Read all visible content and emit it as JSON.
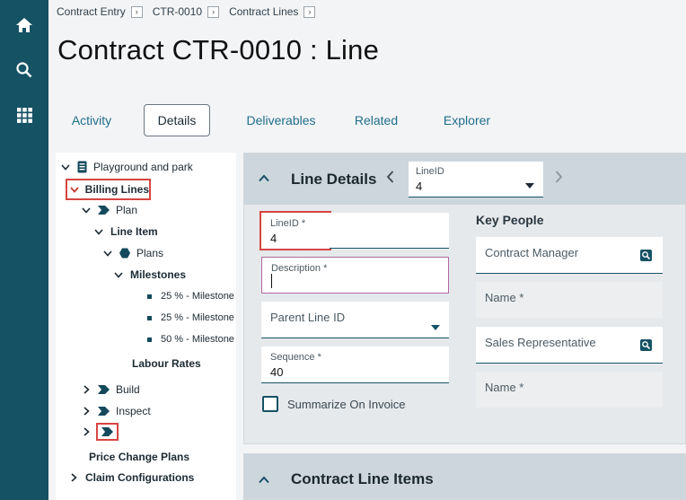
{
  "rail": {
    "items": [
      {
        "icon": "home-icon"
      },
      {
        "icon": "search-icon"
      },
      {
        "icon": "grid-icon"
      }
    ]
  },
  "breadcrumb": [
    "Contract Entry",
    "CTR-0010",
    "Contract Lines"
  ],
  "page_title": "Contract CTR-0010 : Line",
  "tabs": [
    "Activity",
    "Details",
    "Deliverables",
    "Related",
    "Explorer"
  ],
  "active_tab": "Details",
  "tree": {
    "root": "Playground and park",
    "billing_lines": "Billing Lines",
    "plan": "Plan",
    "line_item": "Line Item",
    "plans": "Plans",
    "milestones": "Milestones",
    "milestone_items": [
      "25 % - Milestone",
      "25 % - Milestone",
      "50 % - Milestone"
    ],
    "labour_rates": "Labour Rates",
    "build": "Build",
    "inspect": "Inspect",
    "price_change_plans": "Price Change Plans",
    "claim_configurations": "Claim Configurations"
  },
  "line_details": {
    "title": "Line Details",
    "selector": {
      "label": "LineID",
      "value": "4"
    },
    "lineid": {
      "label": "LineID *",
      "value": "4"
    },
    "description": {
      "label": "Description *",
      "value": ""
    },
    "parent_line": {
      "label": "Parent Line ID"
    },
    "sequence": {
      "label": "Sequence *",
      "value": "40"
    },
    "summarize": {
      "label": "Summarize On Invoice",
      "checked": false
    },
    "key_people": {
      "title": "Key People",
      "contract_manager": "Contract Manager",
      "cm_name": "Name *",
      "sales_rep": "Sales Representative",
      "sr_name": "Name *"
    }
  },
  "contract_line_items": {
    "title": "Contract Line Items"
  },
  "colors": {
    "rail": "#155264",
    "accent": "#1f6e8a",
    "highlight_red": "#d64541"
  }
}
